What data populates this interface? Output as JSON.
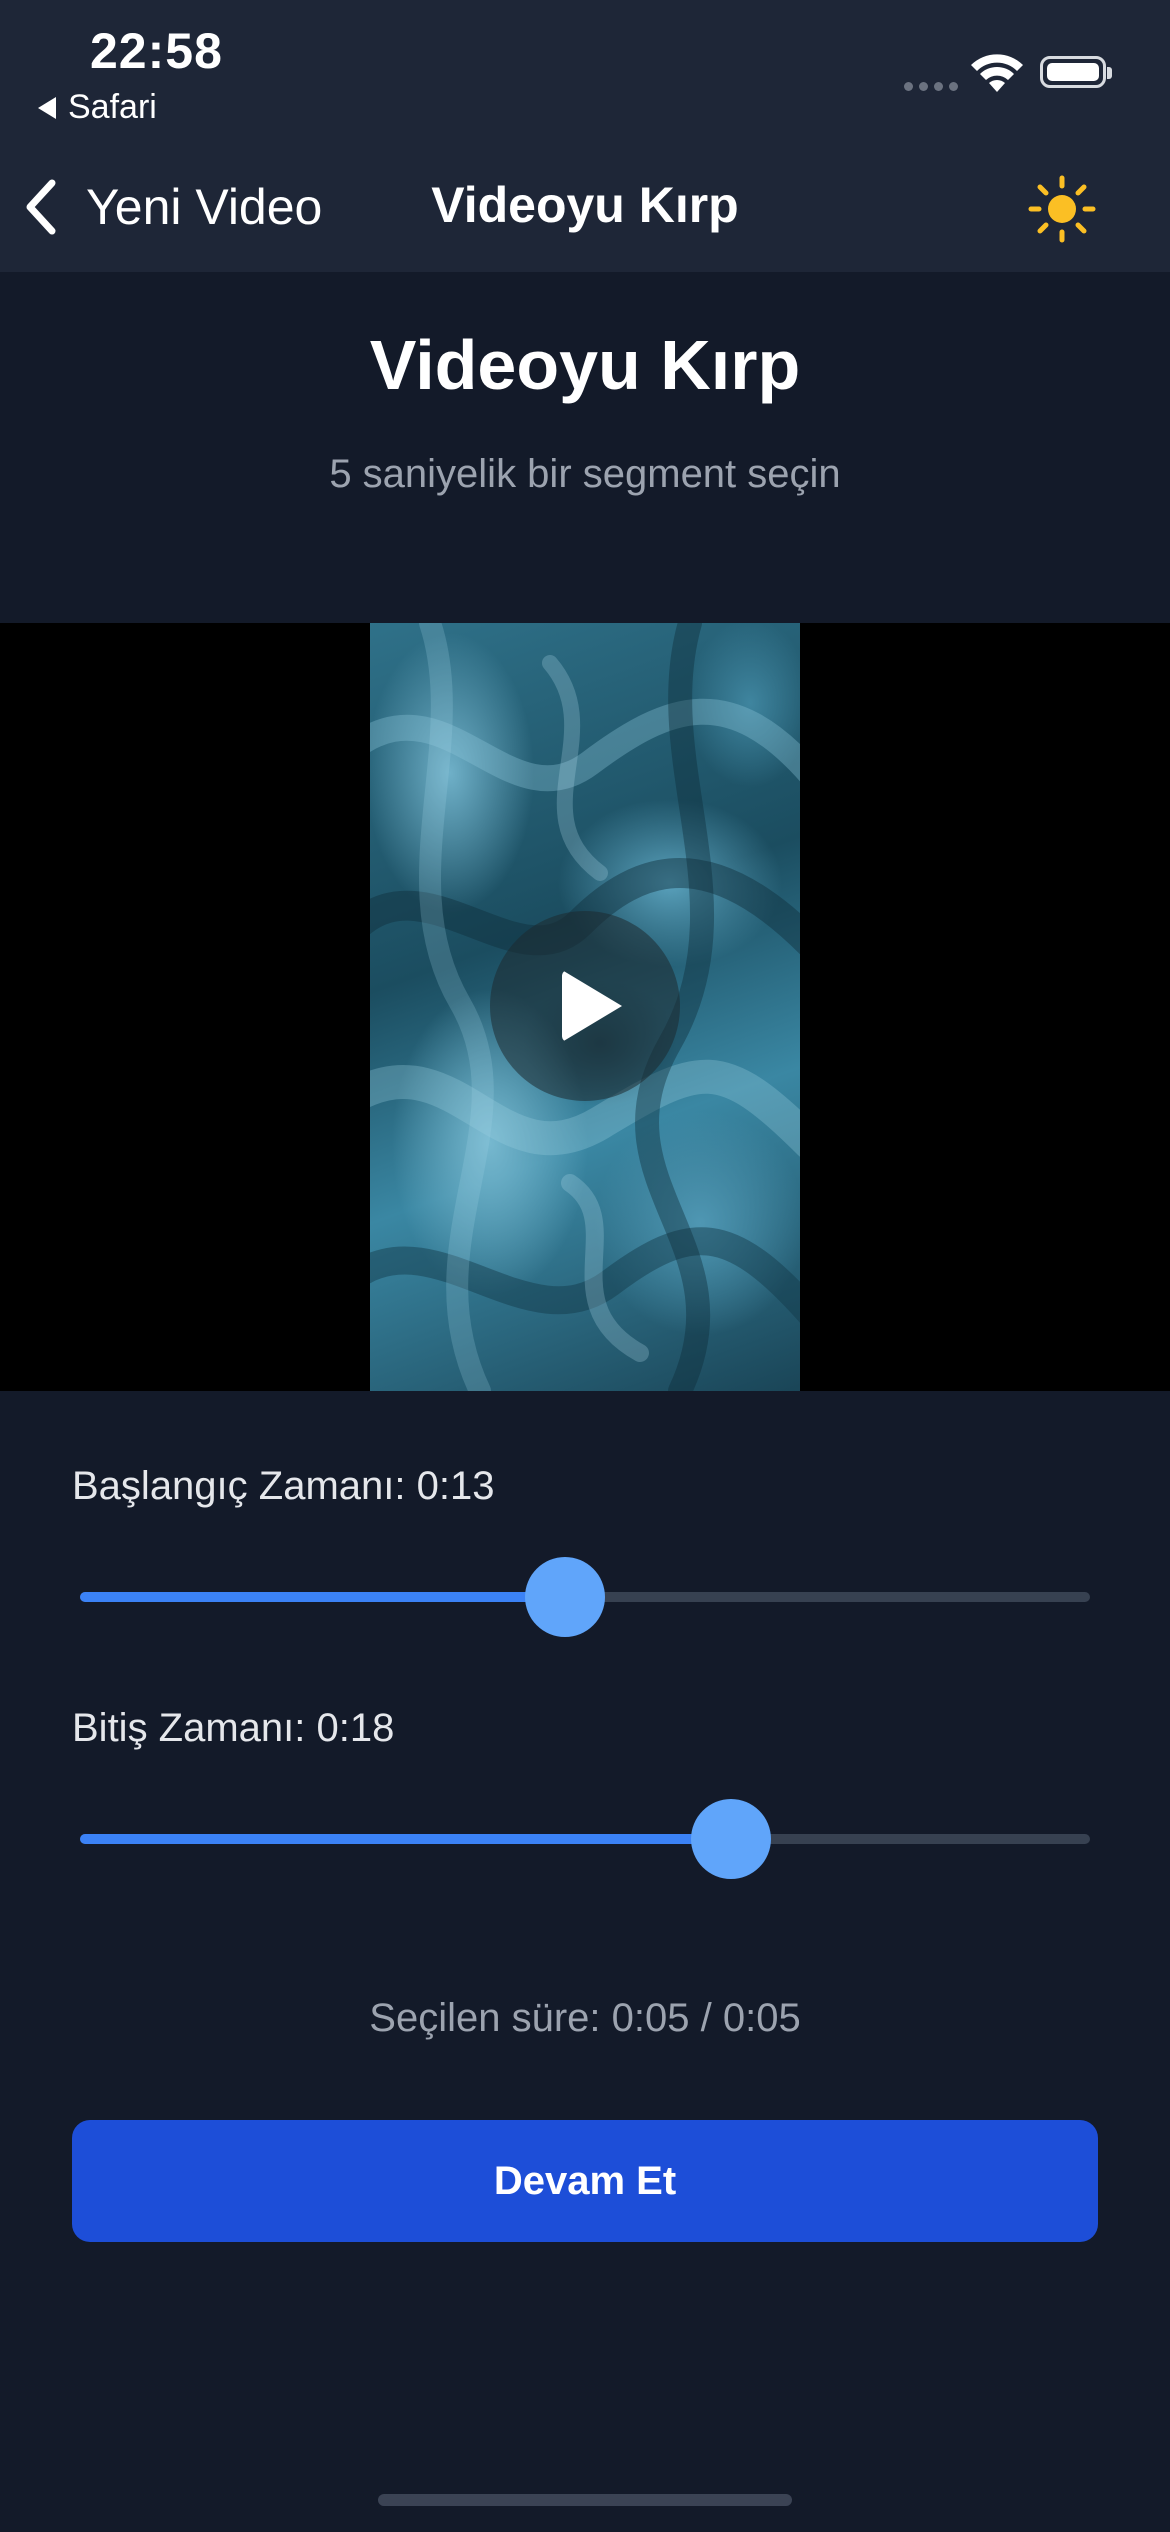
{
  "status_bar": {
    "time": "22:58",
    "back_app": "Safari",
    "icons": [
      "signal-dots-icon",
      "wifi-icon",
      "battery-icon"
    ]
  },
  "nav": {
    "back_label": "Yeni Video",
    "title": "Videoyu Kırp",
    "theme_icon": "sun-icon",
    "accent_color": "#fbbf24"
  },
  "header": {
    "title": "Videoyu Kırp",
    "subtitle": "5 saniyelik bir segment seçin"
  },
  "video": {
    "play_icon": "play-icon"
  },
  "start_slider": {
    "label": "Başlangıç Zamanı: 0:13",
    "value_fraction": 0.48
  },
  "end_slider": {
    "label": "Bitiş Zamanı: 0:18",
    "value_fraction": 0.645
  },
  "duration_text": "Seçilen süre: 0:05 / 0:05",
  "continue_label": "Devam Et",
  "colors": {
    "background": "#131a29",
    "bar": "#1e2637",
    "primary": "#1d4ed8",
    "slider_fill": "#3b82f6",
    "slider_thumb": "#60a5fa"
  }
}
